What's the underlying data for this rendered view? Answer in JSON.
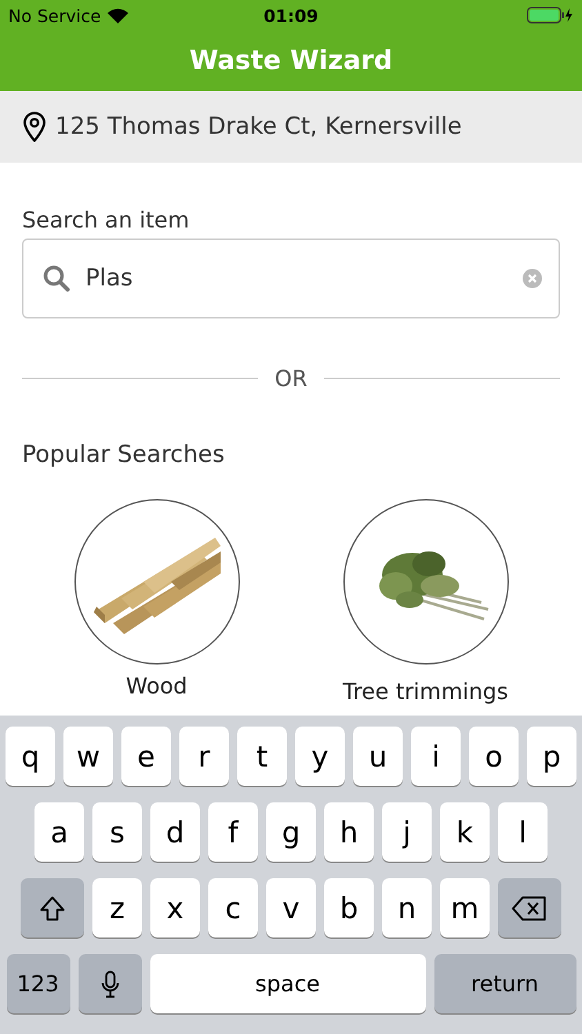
{
  "status_bar": {
    "carrier": "No Service",
    "time": "01:09"
  },
  "header": {
    "title": "Waste Wizard"
  },
  "location": {
    "address": "125 Thomas Drake Ct, Kernersville"
  },
  "search": {
    "label": "Search an item",
    "value": "Plas"
  },
  "divider": {
    "text": "OR"
  },
  "popular": {
    "title": "Popular Searches",
    "items": [
      {
        "label": "Wood",
        "kind": "wood"
      },
      {
        "label": "Tree trimmings",
        "kind": "greens"
      }
    ]
  },
  "keyboard": {
    "letter_rows": [
      [
        {
          "kind": "letter",
          "label": "q"
        },
        {
          "kind": "letter",
          "label": "w"
        },
        {
          "kind": "letter",
          "label": "e"
        },
        {
          "kind": "letter",
          "label": "r"
        },
        {
          "kind": "letter",
          "label": "t"
        },
        {
          "kind": "letter",
          "label": "y"
        },
        {
          "kind": "letter",
          "label": "u"
        },
        {
          "kind": "letter",
          "label": "i"
        },
        {
          "kind": "letter",
          "label": "o"
        },
        {
          "kind": "letter",
          "label": "p"
        }
      ],
      [
        {
          "kind": "letter",
          "label": "a"
        },
        {
          "kind": "letter",
          "label": "s"
        },
        {
          "kind": "letter",
          "label": "d"
        },
        {
          "kind": "letter",
          "label": "f"
        },
        {
          "kind": "letter",
          "label": "g"
        },
        {
          "kind": "letter",
          "label": "h"
        },
        {
          "kind": "letter",
          "label": "j"
        },
        {
          "kind": "letter",
          "label": "k"
        },
        {
          "kind": "letter",
          "label": "l"
        }
      ],
      [
        {
          "kind": "shift"
        },
        {
          "kind": "letter",
          "label": "z"
        },
        {
          "kind": "letter",
          "label": "x"
        },
        {
          "kind": "letter",
          "label": "c"
        },
        {
          "kind": "letter",
          "label": "v"
        },
        {
          "kind": "letter",
          "label": "b"
        },
        {
          "kind": "letter",
          "label": "n"
        },
        {
          "kind": "letter",
          "label": "m"
        },
        {
          "kind": "backspace"
        }
      ]
    ],
    "bottom_keys": [
      {
        "kind": "numbers",
        "label": "123"
      },
      {
        "kind": "mic"
      },
      {
        "kind": "space",
        "label": "space"
      },
      {
        "kind": "return",
        "label": "return"
      }
    ]
  }
}
